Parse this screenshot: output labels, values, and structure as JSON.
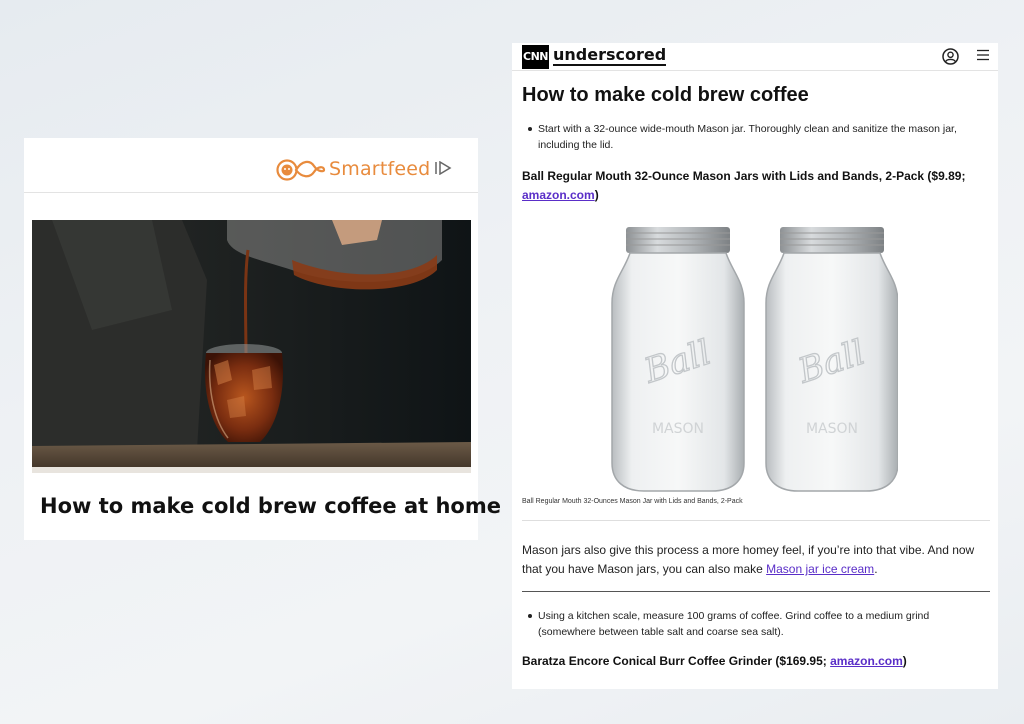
{
  "smartfeed": {
    "brand": "Smartfeed",
    "article_title": "How to make cold brew coffee at home",
    "image_alt": "cold brew coffee pouring into glass",
    "icons": {
      "logo": "smartfeed-infinity-logo-icon",
      "ad_choices": "ad-choices-icon"
    },
    "colors": {
      "brand": "#e88b3d"
    }
  },
  "cnn": {
    "logo_text": "CNN",
    "site_name": "underscored",
    "icons": {
      "account": "user-account-icon",
      "menu": "hamburger-menu-icon"
    },
    "article": {
      "title": "How to make cold brew coffee",
      "bullet_1": "Start with a 32-ounce wide-mouth Mason jar. Thoroughly clean and sanitize the mason jar, including the lid.",
      "product_1_text": "Ball Regular Mouth 32-Ounce Mason Jars with Lids and Bands, 2-Pack ($9.89; ",
      "product_1_link": "amazon.com",
      "product_1_close": ")",
      "image_caption": "Ball Regular Mouth 32-Ounces Mason Jar with Lids and Bands, 2-Pack",
      "jar_embossing_brand": "Ball",
      "jar_embossing_word": "MASON",
      "paragraph_text": "Mason jars also give this process a more homey feel, if you’re into that vibe. And now that you have Mason jars, you can also make ",
      "paragraph_link": "Mason jar ice cream",
      "paragraph_end": ".",
      "bullet_2": "Using a kitchen scale, measure 100 grams of coffee. Grind coffee to a medium grind (somewhere between table salt and coarse sea salt).",
      "product_2_text": "Baratza Encore Conical Burr Coffee Grinder ($169.95; ",
      "product_2_link": "amazon.com",
      "product_2_close": ")"
    },
    "colors": {
      "link": "#5a2ec8"
    }
  }
}
